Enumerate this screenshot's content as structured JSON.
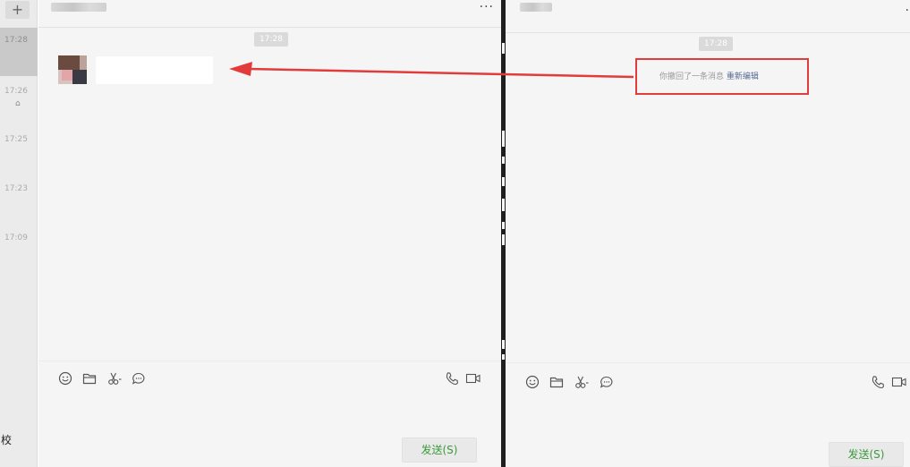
{
  "session_list": {
    "add_label": "+",
    "items": [
      {
        "time": "17:28",
        "sub": ""
      },
      {
        "time": "17:26",
        "sub": "⌂"
      },
      {
        "time": "17:25",
        "sub": ""
      },
      {
        "time": "17:23",
        "sub": ""
      },
      {
        "time": "17:09",
        "sub": ""
      }
    ],
    "bottom_name": "校"
  },
  "left_chat": {
    "more_label": "···",
    "time_chip": "17:28",
    "send_label": "发送(S)"
  },
  "right_chat": {
    "more_label": "·",
    "time_chip": "17:28",
    "recall_text": "你撤回了一条消息",
    "reedit_text": "重新编辑",
    "send_label": "发送(S)"
  },
  "toolbar_icons": [
    "emoji-icon",
    "folder-icon",
    "scissors-icon",
    "chat-bubble-icon",
    "phone-icon",
    "video-icon"
  ],
  "colors": {
    "annotation_red": "#e23b3b",
    "link_blue": "#576b95",
    "send_green": "#3a9a3a",
    "chat_bg": "#f5f5f5"
  }
}
